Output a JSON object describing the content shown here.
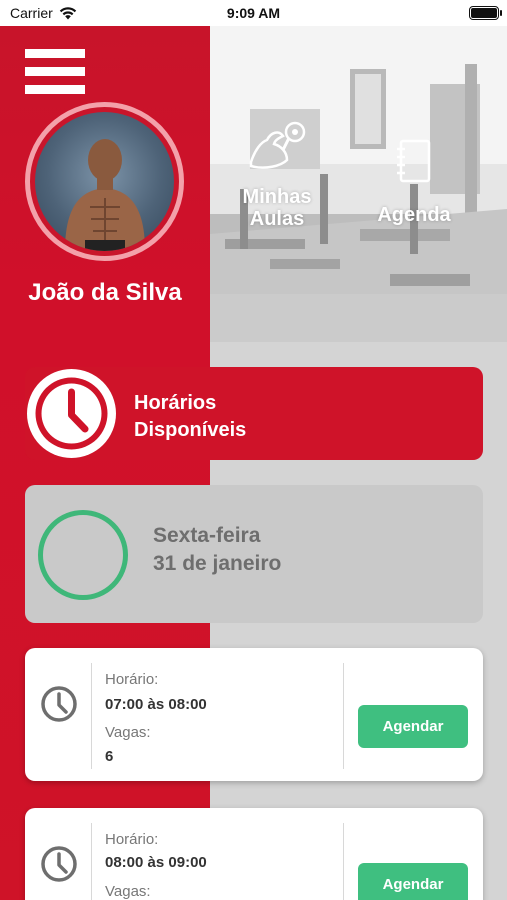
{
  "status_bar": {
    "carrier": "Carrier",
    "time": "9:09 AM"
  },
  "profile": {
    "name": "João da Silva"
  },
  "nav": {
    "aulas_line1": "Minhas",
    "aulas_line2": "Aulas",
    "agenda": "Agenda"
  },
  "available_card": {
    "line1": "Horários",
    "line2": "Disponíveis"
  },
  "date_card": {
    "weekday": "Sexta-feira",
    "date": "31 de janeiro"
  },
  "slots": [
    {
      "time_label": "Horário:",
      "time": "07:00 às 08:00",
      "vagas_label": "Vagas:",
      "vagas": "6",
      "button": "Agendar"
    },
    {
      "time_label": "Horário:",
      "time": "08:00 às 09:00",
      "vagas_label": "Vagas:",
      "vagas": "",
      "button": "Agendar"
    }
  ],
  "colors": {
    "brand_red": "#cf1329",
    "accent_green": "#3fbf80",
    "ring_green": "#3fb779",
    "ring_pink": "#f3a1aa"
  }
}
